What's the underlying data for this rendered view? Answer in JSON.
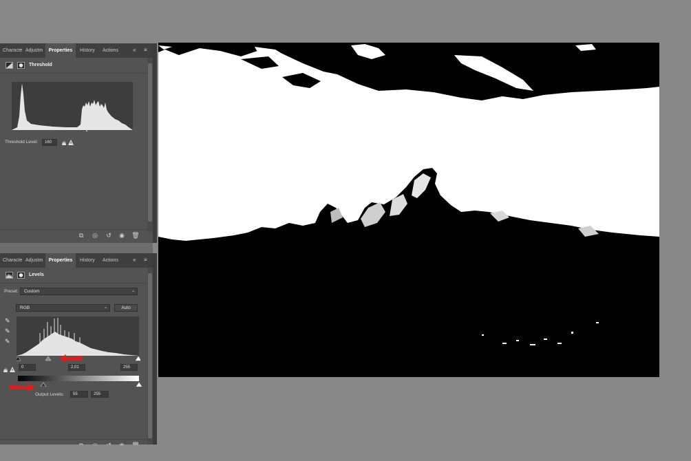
{
  "top_panel": {
    "tabs": [
      "Characte",
      "Adjustm",
      "Properties",
      "History",
      "Actions"
    ],
    "active_tab": "Properties",
    "collapse_icon": "double-chevron-left-icon",
    "menu_icon": "hamburger-menu-icon",
    "adjustment_title": "Threshold",
    "threshold_label": "Threshold Level:",
    "threshold_value": "160",
    "warning_icon": "histogram-warning-icon",
    "footer_icons": [
      "clip-to-layer-icon",
      "view-previous-icon",
      "reset-icon",
      "visibility-eye-icon",
      "trash-icon"
    ]
  },
  "bottom_panel": {
    "tabs": [
      "Characte",
      "Adjustm",
      "Properties",
      "History",
      "Actions"
    ],
    "active_tab": "Properties",
    "adjustment_title": "Levels",
    "preset_label": "Preset:",
    "preset_value": "Custom",
    "channel_value": "RGB",
    "auto_button": "Auto",
    "input_black": "0",
    "input_gamma": "2,01",
    "input_white": "255",
    "output_label": "Output Levels:",
    "output_black": "55",
    "output_white": "255",
    "eyedroppers": [
      "black-point-eyedropper-icon",
      "gray-point-eyedropper-icon",
      "white-point-eyedropper-icon"
    ]
  },
  "annotations": {
    "arrow_color": "#e21b1b",
    "arrows": [
      "red-arrow-gamma",
      "red-arrow-output"
    ]
  },
  "colors": {
    "panel_bg": "#535353",
    "tab_bar_bg": "#3f3f3f",
    "workspace_bg": "#878787",
    "histogram_bg": "#3d3d3d"
  }
}
